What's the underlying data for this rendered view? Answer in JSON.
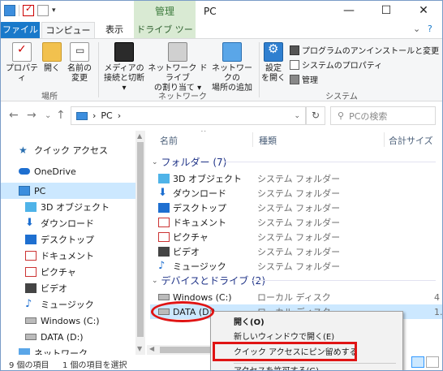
{
  "window": {
    "title": "PC",
    "manage_tab": "管理",
    "controls": {
      "minimize": "—",
      "maximize": "☐",
      "close": "✕"
    }
  },
  "ribbon_tabs": {
    "file": "ファイル",
    "computer": "コンピューター",
    "view": "表示",
    "drive_tools": "ドライブ ツール",
    "collapse": "⌄",
    "help": "?"
  },
  "ribbon": {
    "location": {
      "label": "場所",
      "properties": "プロパティ",
      "open": "開く",
      "rename": [
        "名前の",
        "変更"
      ]
    },
    "network": {
      "label": "ネットワーク",
      "media": [
        "メディアの",
        "接続と切断 ▾"
      ],
      "map_drive": [
        "ネットワーク ドライブ",
        "の割り当て ▾"
      ],
      "add_location": [
        "ネットワークの",
        "場所の追加"
      ]
    },
    "system": {
      "label": "システム",
      "settings": [
        "設定",
        "を開く"
      ],
      "uninstall": "プログラムのアンインストールと変更",
      "sys_props": "システムのプロパティ",
      "manage": "管理"
    }
  },
  "address": {
    "path_root": "PC",
    "chevron": "›",
    "search_placeholder": "PCの検索"
  },
  "nav": {
    "back": "←",
    "forward": "→",
    "recent": "⌄",
    "up": "↑",
    "items": [
      {
        "label": "クイック アクセス"
      },
      {
        "label": "OneDrive"
      },
      {
        "label": "PC"
      },
      {
        "label": "3D オブジェクト"
      },
      {
        "label": "ダウンロード"
      },
      {
        "label": "デスクトップ"
      },
      {
        "label": "ドキュメント"
      },
      {
        "label": "ピクチャ"
      },
      {
        "label": "ビデオ"
      },
      {
        "label": "ミュージック"
      },
      {
        "label": "Windows (C:)"
      },
      {
        "label": "DATA (D:)"
      },
      {
        "label": "ネットワーク"
      }
    ]
  },
  "columns": {
    "name": "名前",
    "type": "種類",
    "size": "合計サイズ"
  },
  "groups": {
    "folders": "フォルダー (7)",
    "drives": "デバイスとドライブ (2)"
  },
  "folders": [
    {
      "name": "3D オブジェクト",
      "type": "システム フォルダー"
    },
    {
      "name": "ダウンロード",
      "type": "システム フォルダー"
    },
    {
      "name": "デスクトップ",
      "type": "システム フォルダー"
    },
    {
      "name": "ドキュメント",
      "type": "システム フォルダー"
    },
    {
      "name": "ピクチャ",
      "type": "システム フォルダー"
    },
    {
      "name": "ビデオ",
      "type": "システム フォルダー"
    },
    {
      "name": "ミュージック",
      "type": "システム フォルダー"
    }
  ],
  "drives": [
    {
      "name": "Windows (C:)",
      "type": "ローカル ディスク",
      "size": "4"
    },
    {
      "name": "DATA (D:)",
      "type": "ローカル ディスク",
      "size": "1."
    }
  ],
  "context_menu": {
    "open": "開く(O)",
    "new_window": "新しいウィンドウで開く(E)",
    "pin_quick_access": "クイック アクセスにピン留めする",
    "allow_access": "アクセスを許可する(G)"
  },
  "status": {
    "count": "9 個の項目",
    "selected": "1 個の項目を選択"
  },
  "colors": {
    "accent": "#1979ca",
    "manage_tab": "#d9ead3",
    "selection": "#cce8ff",
    "annotation": "#e01414"
  }
}
